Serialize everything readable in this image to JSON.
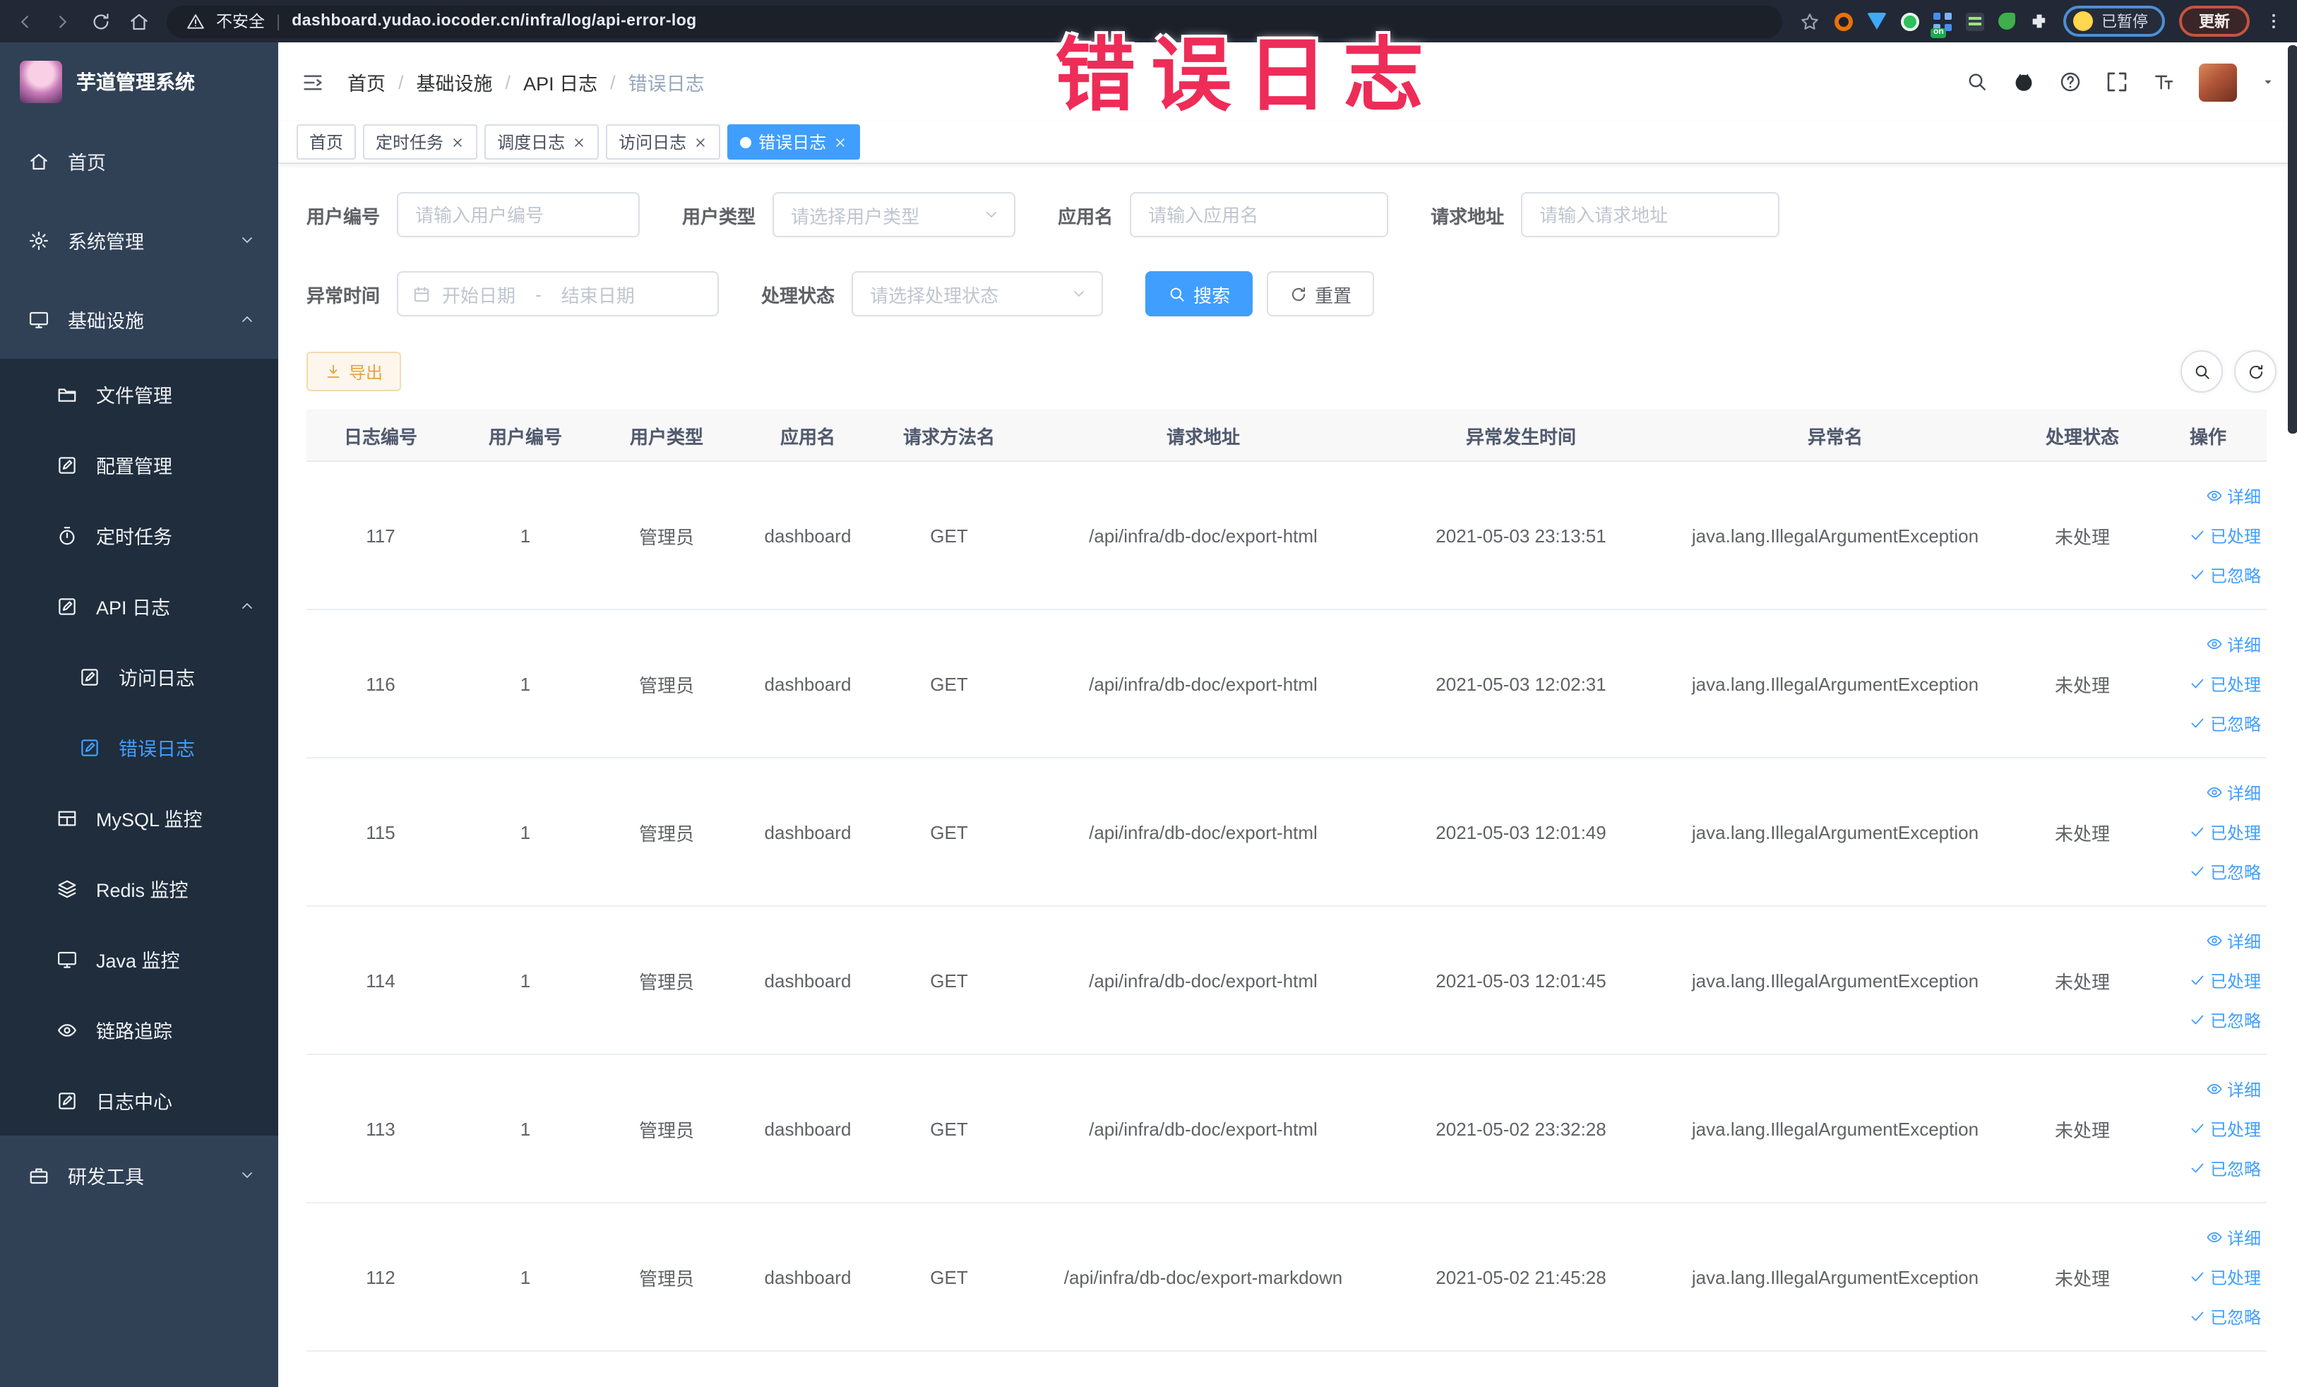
{
  "browser": {
    "security_label": "不安全",
    "url": "dashboard.yudao.iocoder.cn/infra/log/api-error-log",
    "paused_badge": "已暂停",
    "update_button": "更新",
    "extension_on_badge": "on"
  },
  "overlay": {
    "title": "错误日志",
    "color": "#ee2c58"
  },
  "sidebar": {
    "app_title": "芋道管理系统",
    "items": [
      {
        "label": "首页"
      },
      {
        "label": "系统管理"
      },
      {
        "label": "基础设施"
      },
      {
        "label": "文件管理"
      },
      {
        "label": "配置管理"
      },
      {
        "label": "定时任务"
      },
      {
        "label": "API 日志"
      },
      {
        "label": "访问日志"
      },
      {
        "label": "错误日志"
      },
      {
        "label": "MySQL 监控"
      },
      {
        "label": "Redis 监控"
      },
      {
        "label": "Java 监控"
      },
      {
        "label": "链路追踪"
      },
      {
        "label": "日志中心"
      },
      {
        "label": "研发工具"
      }
    ]
  },
  "breadcrumb": {
    "items": [
      "首页",
      "基础设施",
      "API 日志",
      "错误日志"
    ]
  },
  "tabs": [
    {
      "label": "首页",
      "closable": false,
      "active": false
    },
    {
      "label": "定时任务",
      "closable": true,
      "active": false
    },
    {
      "label": "调度日志",
      "closable": true,
      "active": false
    },
    {
      "label": "访问日志",
      "closable": true,
      "active": false
    },
    {
      "label": "错误日志",
      "closable": true,
      "active": true
    }
  ],
  "filters": {
    "user_id": {
      "label": "用户编号",
      "placeholder": "请输入用户编号"
    },
    "user_type": {
      "label": "用户类型",
      "placeholder": "请选择用户类型"
    },
    "app_name": {
      "label": "应用名",
      "placeholder": "请输入应用名"
    },
    "request_url": {
      "label": "请求地址",
      "placeholder": "请输入请求地址"
    },
    "exception_time": {
      "label": "异常时间",
      "start_placeholder": "开始日期",
      "separator": "-",
      "end_placeholder": "结束日期"
    },
    "process_status": {
      "label": "处理状态",
      "placeholder": "请选择处理状态"
    },
    "search_button": "搜索",
    "reset_button": "重置"
  },
  "toolbar": {
    "export_button": "导出"
  },
  "table": {
    "columns": [
      "日志编号",
      "用户编号",
      "用户类型",
      "应用名",
      "请求方法名",
      "请求地址",
      "异常发生时间",
      "异常名",
      "处理状态",
      "操作"
    ],
    "actions": [
      "详细",
      "已处理",
      "已忽略"
    ],
    "rows": [
      {
        "id": "117",
        "user_id": "1",
        "user_type": "管理员",
        "app": "dashboard",
        "method": "GET",
        "url": "/api/infra/db-doc/export-html",
        "time": "2021-05-03 23:13:51",
        "exception": "java.lang.IllegalArgumentException",
        "status": "未处理"
      },
      {
        "id": "116",
        "user_id": "1",
        "user_type": "管理员",
        "app": "dashboard",
        "method": "GET",
        "url": "/api/infra/db-doc/export-html",
        "time": "2021-05-03 12:02:31",
        "exception": "java.lang.IllegalArgumentException",
        "status": "未处理"
      },
      {
        "id": "115",
        "user_id": "1",
        "user_type": "管理员",
        "app": "dashboard",
        "method": "GET",
        "url": "/api/infra/db-doc/export-html",
        "time": "2021-05-03 12:01:49",
        "exception": "java.lang.IllegalArgumentException",
        "status": "未处理"
      },
      {
        "id": "114",
        "user_id": "1",
        "user_type": "管理员",
        "app": "dashboard",
        "method": "GET",
        "url": "/api/infra/db-doc/export-html",
        "time": "2021-05-03 12:01:45",
        "exception": "java.lang.IllegalArgumentException",
        "status": "未处理"
      },
      {
        "id": "113",
        "user_id": "1",
        "user_type": "管理员",
        "app": "dashboard",
        "method": "GET",
        "url": "/api/infra/db-doc/export-html",
        "time": "2021-05-02 23:32:28",
        "exception": "java.lang.IllegalArgumentException",
        "status": "未处理"
      },
      {
        "id": "112",
        "user_id": "1",
        "user_type": "管理员",
        "app": "dashboard",
        "method": "GET",
        "url": "/api/infra/db-doc/export-markdown",
        "time": "2021-05-02 21:45:28",
        "exception": "java.lang.IllegalArgumentException",
        "status": "未处理"
      }
    ]
  }
}
